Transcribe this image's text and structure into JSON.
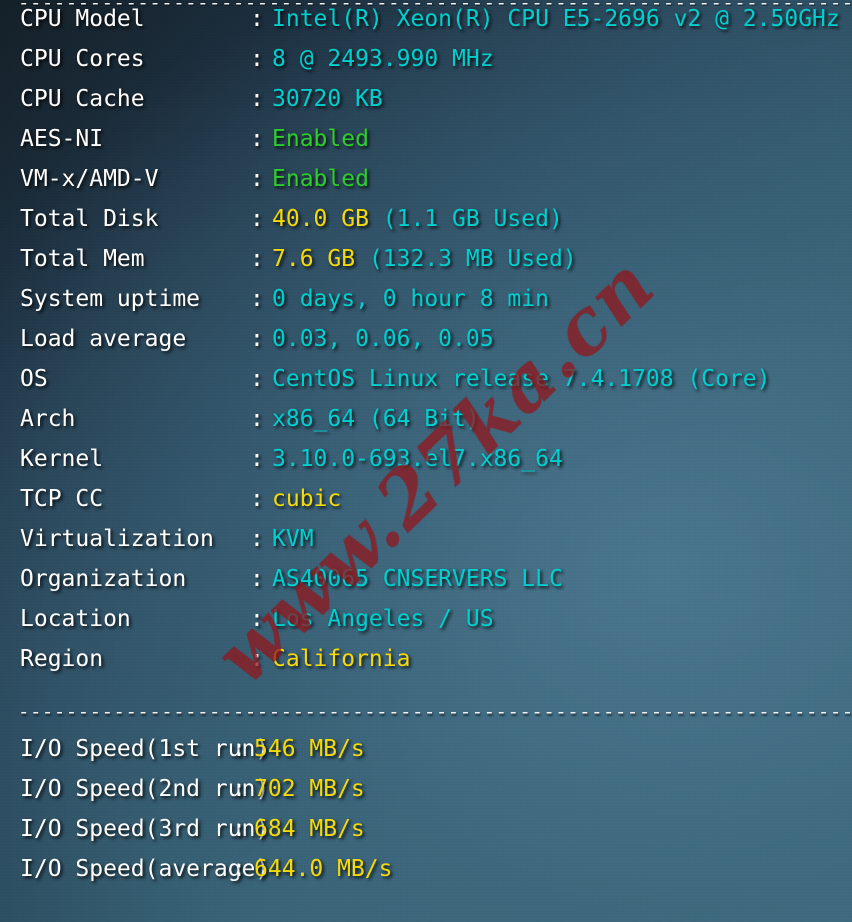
{
  "separators": {
    "top": "----------------------------------------------------------------------",
    "middle": "----------------------------------------------------------------------",
    "bottom": "----------------------------------------------------------------------"
  },
  "watermark": {
    "text": "www.27ka.cn",
    "color": "#96191e"
  },
  "colors": {
    "label": "#ffffff",
    "cyan": "#00cfcf",
    "green": "#2ecc2e",
    "yellow": "#f5d90a",
    "background_dark": "#16222a",
    "background_light": "#3d6a7d"
  },
  "separator_char": ":",
  "system_info": [
    {
      "label": "CPU Model",
      "value": "Intel(R) Xeon(R) CPU E5-2696 v2 @ 2.50GHz",
      "color": "cyan",
      "extra": ""
    },
    {
      "label": "CPU Cores",
      "value": "8 @ 2493.990 MHz",
      "color": "cyan",
      "extra": ""
    },
    {
      "label": "CPU Cache",
      "value": "30720 KB",
      "color": "cyan",
      "extra": ""
    },
    {
      "label": "AES-NI",
      "value": "Enabled",
      "color": "green",
      "extra": ""
    },
    {
      "label": "VM-x/AMD-V",
      "value": "Enabled",
      "color": "green",
      "extra": ""
    },
    {
      "label": "Total Disk",
      "value": "40.0 GB",
      "color": "yellow",
      "extra": "(1.1 GB Used)"
    },
    {
      "label": "Total Mem",
      "value": "7.6 GB",
      "color": "yellow",
      "extra": "(132.3 MB Used)"
    },
    {
      "label": "System uptime",
      "value": "0 days, 0 hour 8 min",
      "color": "cyan",
      "extra": ""
    },
    {
      "label": "Load average",
      "value": "0.03, 0.06, 0.05",
      "color": "cyan",
      "extra": ""
    },
    {
      "label": "OS",
      "value": "CentOS Linux release 7.4.1708 (Core)",
      "color": "cyan",
      "extra": ""
    },
    {
      "label": "Arch",
      "value": "x86_64 (64 Bit)",
      "color": "cyan",
      "extra": ""
    },
    {
      "label": "Kernel",
      "value": "3.10.0-693.el7.x86_64",
      "color": "cyan",
      "extra": ""
    },
    {
      "label": "TCP CC",
      "value": "cubic",
      "color": "yellow",
      "extra": ""
    },
    {
      "label": "Virtualization",
      "value": "KVM",
      "color": "cyan",
      "extra": ""
    },
    {
      "label": "Organization",
      "value": "AS40065 CNSERVERS LLC",
      "color": "cyan",
      "extra": ""
    },
    {
      "label": "Location",
      "value": "Los Angeles / US",
      "color": "cyan",
      "extra": ""
    },
    {
      "label": "Region",
      "value": "California",
      "color": "yellow",
      "extra": ""
    }
  ],
  "io_speed": [
    {
      "label": "I/O Speed(1st run)",
      "value": "546 MB/s",
      "color": "yellow",
      "extra": ""
    },
    {
      "label": "I/O Speed(2nd run)",
      "value": "702 MB/s",
      "color": "yellow",
      "extra": ""
    },
    {
      "label": "I/O Speed(3rd run)",
      "value": "684 MB/s",
      "color": "yellow",
      "extra": ""
    },
    {
      "label": "I/O Speed(average)",
      "value": "644.0 MB/s",
      "color": "yellow",
      "extra": ""
    }
  ]
}
